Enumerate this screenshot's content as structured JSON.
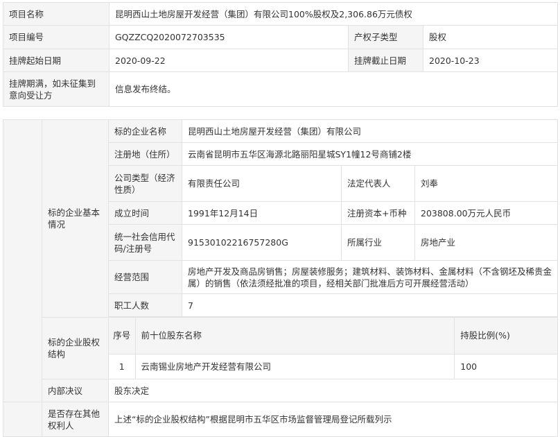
{
  "project": {
    "name_label": "项目名称",
    "name_value": "昆明西山土地房屋开发经营（集团）有限公司100%股权及2,306.86万元债权",
    "code_label": "项目编号",
    "code_value": "GQZZCQ2020072703535",
    "subtype_label": "产权子类型",
    "subtype_value": "股权",
    "start_label": "挂牌起始日期",
    "start_value": "2020-09-22",
    "end_label": "挂牌截止日期",
    "end_value": "2020-10-23",
    "expire_label": "挂牌期满，如未征集到意向受让方",
    "expire_value": "信息发布终结。"
  },
  "target": {
    "basic_label": "标的企业基本情况",
    "company_name_label": "标的企业名称",
    "company_name_value": "昆明西山土地房屋开发经营（集团）有限公司",
    "address_label": "注册地（住所）",
    "address_value": "云南省昆明市五华区海源北路丽阳星城SY1幢12号商铺2楼",
    "type_label": "公司类型（经济性质）",
    "type_value": "有限责任公司",
    "legal_rep_label": "法定代表人",
    "legal_rep_value": "刘奉",
    "founded_label": "成立时间",
    "founded_value": "1991年12月14日",
    "capital_label": "注册资本+币种",
    "capital_value": "203808.00万元人民币",
    "credit_label": "统一社会信用代码/注册号",
    "credit_value": "91530102216757280G",
    "industry_label": "所属行业",
    "industry_value": "房地产业",
    "scope_label": "经营范围",
    "scope_value": "房地产开发及商品房销售；房屋装修服务；建筑材料、装饰材料、金属材料（不含钢坯及稀贵金属）的销售（依法须经批准的项目，经相关部门批准后方可开展经营活动）",
    "staff_label": "职工人数",
    "staff_value": "7",
    "equity_label": "标的企业股权结构",
    "equity_header": {
      "seq": "序号",
      "holder": "前十位股东名称",
      "ratio": "持股比例(%)"
    },
    "equity_rows": [
      {
        "seq": "1",
        "holder": "云南锡业房地产开发经营有限公司",
        "ratio": "100"
      }
    ],
    "decision_label": "内部决议",
    "decision_value": "股东决定",
    "other_rights_label": "是否存在其他权利人",
    "other_rights_value": "上述“标的企业股权结构”根据昆明市五华区市场监督管理局登记所载列示"
  }
}
